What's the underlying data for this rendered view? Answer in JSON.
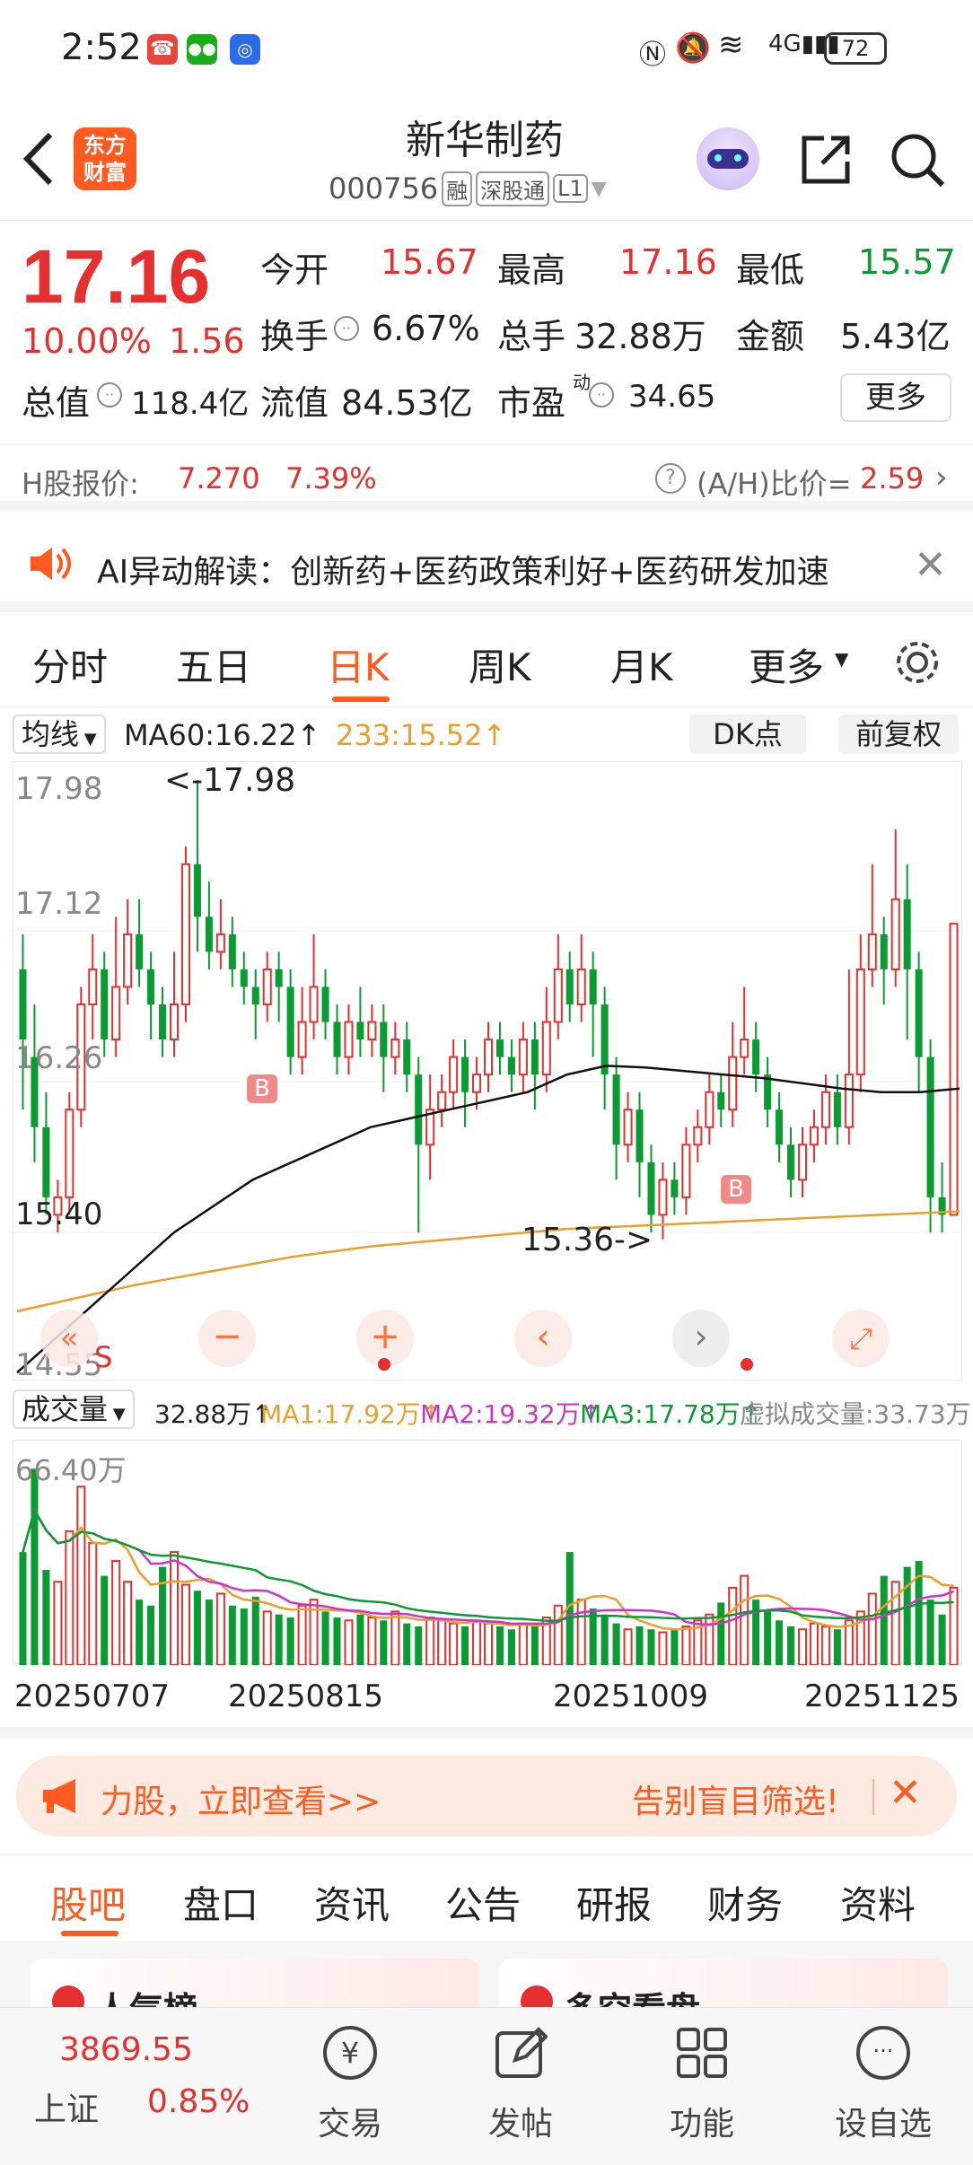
{
  "status_bar": {
    "time": "2:52",
    "battery": "72",
    "network": "4G"
  },
  "header": {
    "brand_line1": "东方",
    "brand_line2": "财富",
    "title": "新华制药",
    "code": "000756",
    "badges": [
      "融",
      "深股通",
      "L1"
    ]
  },
  "quote": {
    "price": "17.16",
    "change_pct": "10.00%",
    "change": "1.56",
    "open_label": "今开",
    "open": "15.67",
    "high_label": "最高",
    "high": "17.16",
    "low_label": "最低",
    "low": "15.57",
    "turnover_label": "换手",
    "turnover": "6.67%",
    "volume_label": "总手",
    "volume": "32.88万",
    "amount_label": "金额",
    "amount": "5.43亿",
    "mktcap_label": "总值",
    "mktcap": "118.4亿",
    "float_label": "流值",
    "float_cap": "84.53亿",
    "pe_label": "市盈",
    "pe_sup": "动",
    "pe": "34.65",
    "more_button": "更多"
  },
  "hshare": {
    "label": "H股报价:",
    "price": "7.270",
    "pct": "7.39%",
    "ratio_label": "(A/H)比价=",
    "ratio": "2.59"
  },
  "ai_banner": {
    "text": "AI异动解读：创新药+医药政策利好+医药研发加速"
  },
  "chart_tabs": [
    "分时",
    "五日",
    "日K",
    "周K",
    "月K",
    "更多"
  ],
  "active_tab": "日K",
  "kline_header": {
    "indicator": "均线",
    "ma60_label": "MA60:16.22↑",
    "ma233_label": "233:15.52↑",
    "dk_button": "DK点",
    "adjust_button": "前复权"
  },
  "kline_axis": {
    "y_labels": [
      "17.98",
      "17.12",
      "16.26",
      "15.40",
      "14.55"
    ],
    "max_note": "<-17.98",
    "min_note": "15.36->",
    "buy_marker": "B",
    "s_marker": "S"
  },
  "volume_header": {
    "indicator": "成交量",
    "value": "32.88万↑",
    "ma1": "MA1:17.92万↑",
    "ma2": "MA2:19.32万↑",
    "ma3": "MA3:17.78万↑",
    "virtual": "虚拟成交量:33.73万",
    "y_max": "66.40万"
  },
  "date_axis": [
    "20250707",
    "20250815",
    "20251009",
    "20251125"
  ],
  "promo": {
    "left": "力股，立即查看>>",
    "right": "告别盲目筛选!"
  },
  "section_tabs": [
    "股吧",
    "盘口",
    "资讯",
    "公告",
    "研报",
    "财务",
    "资料"
  ],
  "cards": [
    "人气榜",
    "多空看盘"
  ],
  "bottom_nav": {
    "index_value": "3869.55",
    "index_name": "上证",
    "index_pct": "0.85%",
    "items": [
      "交易",
      "发帖",
      "功能",
      "设自选"
    ]
  },
  "colors": {
    "up": "#e5302f",
    "down": "#0a9b32",
    "ma60": "#111111",
    "ma233": "#e8a02a",
    "ma1": "#e8a02a",
    "ma2": "#cc33cc",
    "ma3": "#0a9b32",
    "accent": "#ff5a1f"
  },
  "chart_data": {
    "type": "candlestick",
    "y_range": [
      14.55,
      17.98
    ],
    "candles": [
      [
        16.9,
        16.5,
        17.1,
        16.1
      ],
      [
        16.4,
        16.0,
        16.7,
        15.8
      ],
      [
        16.0,
        15.6,
        16.2,
        15.5
      ],
      [
        15.5,
        15.6,
        15.7,
        15.4
      ],
      [
        15.6,
        16.1,
        16.2,
        15.5
      ],
      [
        16.1,
        16.7,
        16.8,
        16.0
      ],
      [
        16.7,
        16.9,
        17.1,
        16.5
      ],
      [
        16.9,
        16.5,
        17.0,
        16.4
      ],
      [
        16.5,
        16.8,
        17.2,
        16.4
      ],
      [
        16.8,
        17.1,
        17.3,
        16.7
      ],
      [
        17.1,
        16.9,
        17.3,
        16.8
      ],
      [
        16.9,
        16.7,
        17.0,
        16.5
      ],
      [
        16.7,
        16.5,
        16.8,
        16.4
      ],
      [
        16.5,
        16.7,
        17.0,
        16.4
      ],
      [
        16.7,
        17.5,
        17.6,
        16.6
      ],
      [
        17.5,
        17.2,
        17.98,
        17.0
      ],
      [
        17.2,
        17.0,
        17.4,
        16.9
      ],
      [
        17.0,
        17.1,
        17.3,
        16.9
      ],
      [
        17.1,
        16.9,
        17.2,
        16.8
      ],
      [
        16.9,
        16.8,
        17.0,
        16.7
      ],
      [
        16.8,
        16.7,
        16.9,
        16.5
      ],
      [
        16.7,
        16.9,
        17.0,
        16.6
      ],
      [
        16.9,
        16.8,
        17.0,
        16.6
      ],
      [
        16.8,
        16.4,
        16.9,
        16.3
      ],
      [
        16.4,
        16.6,
        16.8,
        16.3
      ],
      [
        16.6,
        16.8,
        17.1,
        16.5
      ],
      [
        16.8,
        16.6,
        16.9,
        16.5
      ],
      [
        16.6,
        16.4,
        16.7,
        16.3
      ],
      [
        16.4,
        16.6,
        16.7,
        16.3
      ],
      [
        16.6,
        16.5,
        16.8,
        16.4
      ],
      [
        16.5,
        16.6,
        16.7,
        16.4
      ],
      [
        16.6,
        16.4,
        16.7,
        16.2
      ],
      [
        16.4,
        16.5,
        16.6,
        16.3
      ],
      [
        16.5,
        16.3,
        16.6,
        16.2
      ],
      [
        16.3,
        15.9,
        16.4,
        15.4
      ],
      [
        15.9,
        16.1,
        16.3,
        15.7
      ],
      [
        16.1,
        16.2,
        16.3,
        16.0
      ],
      [
        16.2,
        16.4,
        16.5,
        16.1
      ],
      [
        16.4,
        16.2,
        16.5,
        16.0
      ],
      [
        16.2,
        16.3,
        16.4,
        16.1
      ],
      [
        16.3,
        16.5,
        16.6,
        16.2
      ],
      [
        16.5,
        16.4,
        16.6,
        16.3
      ],
      [
        16.4,
        16.3,
        16.5,
        16.2
      ],
      [
        16.3,
        16.5,
        16.6,
        16.2
      ],
      [
        16.5,
        16.3,
        16.6,
        16.1
      ],
      [
        16.3,
        16.6,
        16.8,
        16.2
      ],
      [
        16.6,
        16.9,
        17.1,
        16.5
      ],
      [
        16.9,
        16.7,
        17.0,
        16.6
      ],
      [
        16.7,
        16.9,
        17.1,
        16.6
      ],
      [
        16.9,
        16.7,
        17.0,
        16.4
      ],
      [
        16.7,
        16.3,
        16.8,
        16.1
      ],
      [
        16.3,
        15.9,
        16.4,
        15.7
      ],
      [
        15.9,
        16.1,
        16.2,
        15.8
      ],
      [
        16.1,
        15.8,
        16.2,
        15.6
      ],
      [
        15.8,
        15.5,
        15.9,
        15.4
      ],
      [
        15.5,
        15.7,
        15.8,
        15.36
      ],
      [
        15.7,
        15.6,
        15.8,
        15.5
      ],
      [
        15.6,
        15.9,
        16.0,
        15.5
      ],
      [
        15.9,
        16.0,
        16.1,
        15.8
      ],
      [
        16.0,
        16.2,
        16.3,
        15.9
      ],
      [
        16.2,
        16.1,
        16.3,
        16.0
      ],
      [
        16.1,
        16.4,
        16.6,
        16.0
      ],
      [
        16.4,
        16.5,
        16.8,
        16.3
      ],
      [
        16.5,
        16.3,
        16.6,
        16.2
      ],
      [
        16.3,
        16.1,
        16.4,
        16.0
      ],
      [
        16.1,
        15.9,
        16.2,
        15.8
      ],
      [
        15.9,
        15.7,
        16.0,
        15.6
      ],
      [
        15.7,
        15.9,
        16.0,
        15.6
      ],
      [
        15.9,
        16.0,
        16.1,
        15.8
      ],
      [
        16.0,
        16.2,
        16.3,
        15.9
      ],
      [
        16.2,
        16.0,
        16.3,
        15.9
      ],
      [
        16.0,
        16.3,
        16.9,
        15.9
      ],
      [
        16.3,
        16.9,
        17.1,
        16.2
      ],
      [
        16.9,
        17.1,
        17.5,
        16.8
      ],
      [
        17.1,
        16.9,
        17.2,
        16.7
      ],
      [
        16.9,
        17.3,
        17.7,
        16.8
      ],
      [
        17.3,
        16.9,
        17.5,
        16.5
      ],
      [
        16.9,
        16.4,
        17.0,
        16.2
      ],
      [
        16.4,
        15.6,
        16.5,
        15.4
      ],
      [
        15.6,
        15.5,
        15.8,
        15.4
      ],
      [
        15.5,
        17.16,
        17.16,
        15.5
      ]
    ],
    "ma60": [
      14.6,
      14.8,
      15.0,
      15.2,
      15.4,
      15.55,
      15.7,
      15.8,
      15.9,
      16.0,
      16.05,
      16.1,
      16.15,
      16.2,
      16.3,
      16.35,
      16.34,
      16.32,
      16.3,
      16.28,
      16.25,
      16.22,
      16.2,
      16.2,
      16.22
    ],
    "ma233": [
      14.95,
      15.0,
      15.05,
      15.1,
      15.14,
      15.18,
      15.22,
      15.26,
      15.29,
      15.32,
      15.34,
      15.36,
      15.38,
      15.4,
      15.42,
      15.43,
      15.44,
      15.45,
      15.46,
      15.47,
      15.48,
      15.49,
      15.5,
      15.51,
      15.52
    ],
    "volume_y_max": 66.4,
    "volumes": [
      38,
      66,
      32,
      28,
      45,
      60,
      41,
      30,
      35,
      28,
      22,
      20,
      33,
      38,
      27,
      25,
      22,
      24,
      20,
      19,
      23,
      18,
      17,
      16,
      20,
      22,
      18,
      16,
      15,
      17,
      16,
      15,
      18,
      14,
      13,
      16,
      15,
      14,
      13,
      15,
      14,
      13,
      12,
      14,
      13,
      16,
      20,
      38,
      22,
      19,
      17,
      14,
      12,
      13,
      12,
      11,
      12,
      13,
      15,
      17,
      21,
      26,
      30,
      22,
      18,
      15,
      13,
      12,
      14,
      13,
      12,
      15,
      18,
      24,
      30,
      28,
      33,
      35,
      22,
      17,
      26
    ]
  }
}
